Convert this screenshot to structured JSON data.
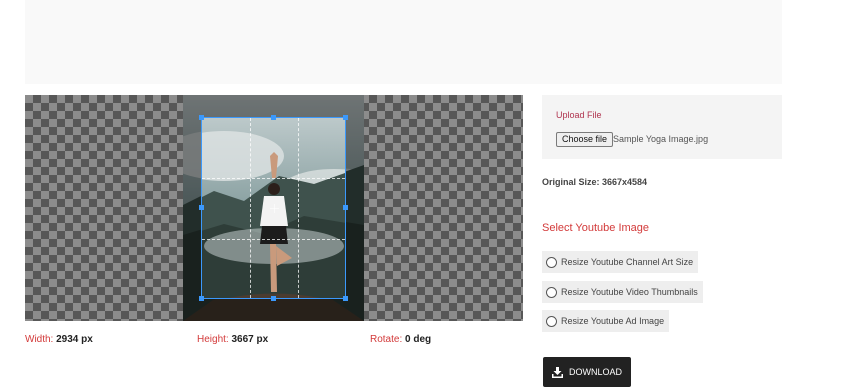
{
  "image_filename": "Sample Yoga Image.jpg",
  "readouts": {
    "width_label": "Width:",
    "width_value": "2934 px",
    "height_label": "Height:",
    "height_value": "3667 px",
    "rotate_label": "Rotate:",
    "rotate_value": "0 deg"
  },
  "upload": {
    "label": "Upload File",
    "choose_button": "Choose file",
    "file_name": "Sample Yoga Image.jpg"
  },
  "original_size": "Original Size: 3667x4584",
  "select_section": {
    "title": "Select Youtube Image",
    "options": [
      "Resize Youtube Channel Art Size",
      "Resize Youtube Video Thumbnails",
      "Resize Youtube Ad Image"
    ]
  },
  "download_label": "DOWNLOAD",
  "colors": {
    "accent_red": "#d33a3a",
    "crop_blue": "#3b99fc",
    "button_dark": "#222222"
  }
}
